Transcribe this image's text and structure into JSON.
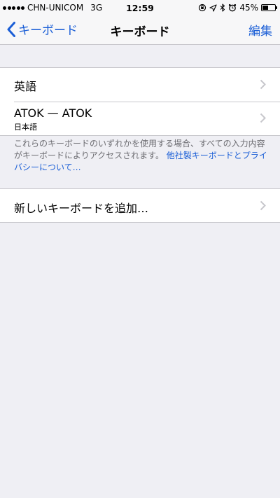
{
  "status_bar": {
    "carrier": "CHN-UNICOM",
    "network": "3G",
    "time": "12:59",
    "battery_percent_text": "45%",
    "battery_level": 0.45,
    "icons": [
      "signal-dots-icon",
      "orientation-lock-icon",
      "location-arrow-icon",
      "bluetooth-icon",
      "alarm-icon",
      "battery-icon"
    ]
  },
  "nav": {
    "back_label": "キーボード",
    "title": "キーボード",
    "edit_label": "編集"
  },
  "keyboards": [
    {
      "label": "英語",
      "sublabel": ""
    },
    {
      "label": "ATOK — ATOK",
      "sublabel": "日本語"
    }
  ],
  "footer": {
    "text": "これらのキーボードのいずれかを使用する場合、すべての入力内容がキーボードによりアクセスされます。",
    "link": "他社製キーボードとプライバシーについて…"
  },
  "add_keyboard": {
    "label": "新しいキーボードを追加…"
  },
  "colors": {
    "accent": "#1a5ed6",
    "background": "#efeff4",
    "separator": "#c8c7cc"
  }
}
